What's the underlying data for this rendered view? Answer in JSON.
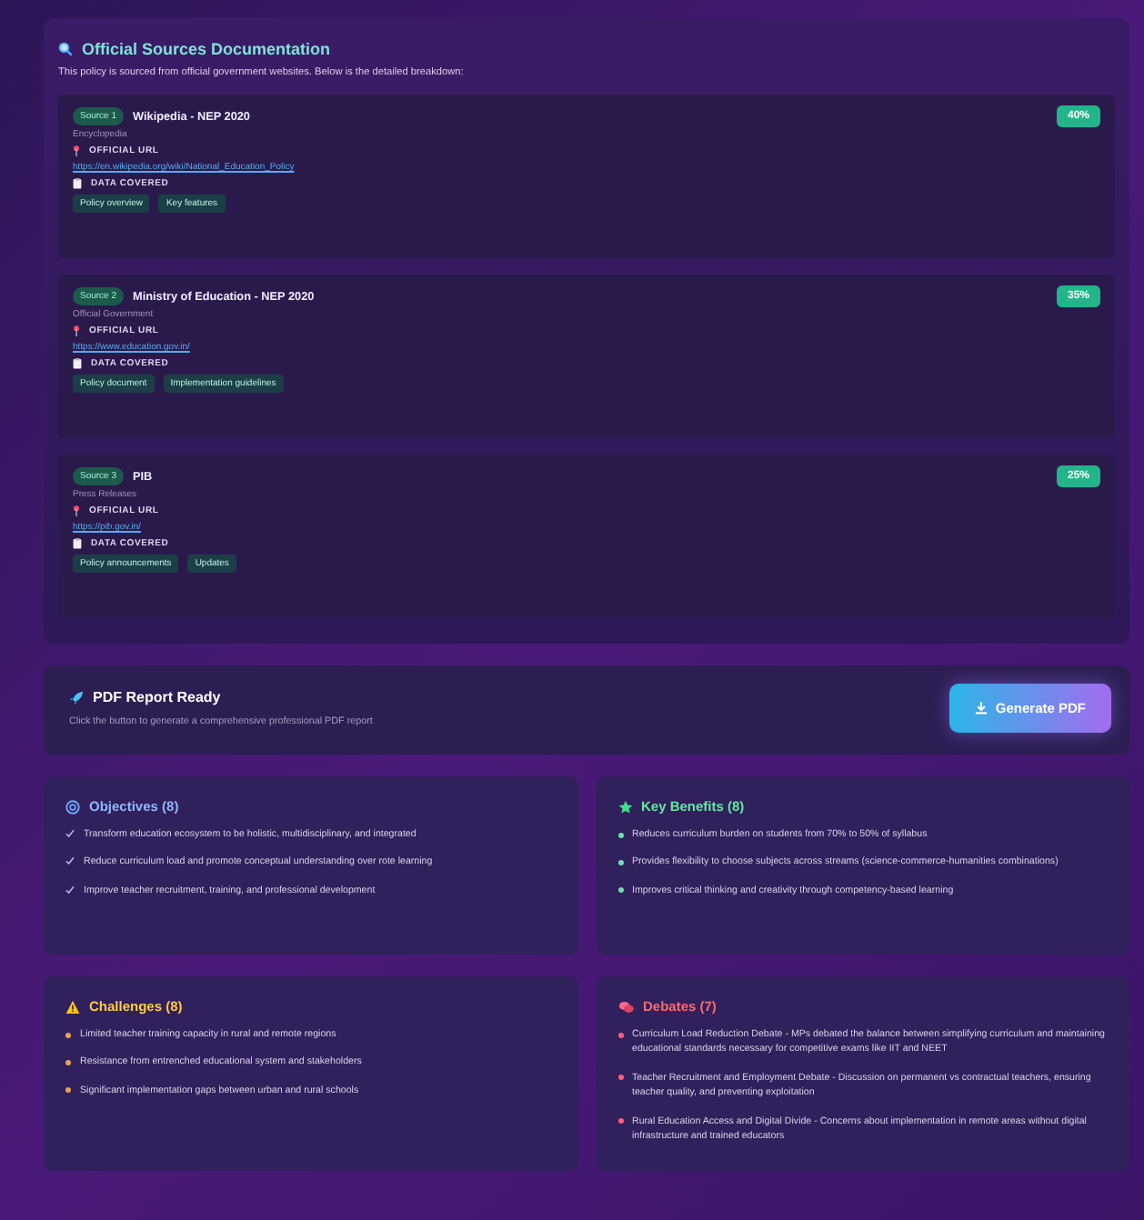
{
  "sources_panel": {
    "title": "Official Sources Documentation",
    "description": "This policy is sourced from official government websites. Below is the detailed breakdown:",
    "sources": [
      {
        "badge": "Source 1",
        "name": "Wikipedia - NEP 2020",
        "type": "Encyclopedia",
        "share": "40%",
        "url_label": "OFFICIAL URL",
        "url": "https://en.wikipedia.org/wiki/National_Education_Policy",
        "data_label": "DATA COVERED",
        "tags": [
          "Policy overview",
          "Key features"
        ]
      },
      {
        "badge": "Source 2",
        "name": "Ministry of Education - NEP 2020",
        "type": "Official Government",
        "share": "35%",
        "url_label": "OFFICIAL URL",
        "url": "https://www.education.gov.in/",
        "data_label": "DATA COVERED",
        "tags": [
          "Policy document",
          "Implementation guidelines"
        ]
      },
      {
        "badge": "Source 3",
        "name": "PIB",
        "type": "Press Releases",
        "share": "25%",
        "url_label": "OFFICIAL URL",
        "url": "https://pib.gov.in/",
        "data_label": "DATA COVERED",
        "tags": [
          "Policy announcements",
          "Updates"
        ]
      }
    ]
  },
  "pdf_banner": {
    "title": "PDF Report Ready",
    "description": "Click the button to generate a comprehensive professional PDF report",
    "button": "Generate PDF"
  },
  "sections": [
    {
      "kind": "objectives",
      "title": "Objectives (8)",
      "items": [
        "Transform education ecosystem to be holistic, multidisciplinary, and integrated",
        "Reduce curriculum load and promote conceptual understanding over rote learning",
        "Improve teacher recruitment, training, and professional development"
      ]
    },
    {
      "kind": "benefits",
      "title": "Key Benefits (8)",
      "items": [
        "Reduces curriculum burden on students from 70% to 50% of syllabus",
        "Provides flexibility to choose subjects across streams (science-commerce-humanities combinations)",
        "Improves critical thinking and creativity through competency-based learning"
      ]
    },
    {
      "kind": "challenges",
      "title": "Challenges (8)",
      "items": [
        "Limited teacher training capacity in rural and remote regions",
        "Resistance from entrenched educational system and stakeholders",
        "Significant implementation gaps between urban and rural schools"
      ]
    },
    {
      "kind": "debates",
      "title": "Debates (7)",
      "items": [
        "Curriculum Load Reduction Debate - MPs debated the balance between simplifying curriculum and maintaining educational standards necessary for competitive exams like IIT and NEET",
        "Teacher Recruitment and Employment Debate - Discussion on permanent vs contractual teachers, ensuring teacher quality, and preventing exploitation",
        "Rural Education Access and Digital Divide - Concerns about implementation in remote areas without digital infrastructure and trained educators"
      ]
    }
  ]
}
